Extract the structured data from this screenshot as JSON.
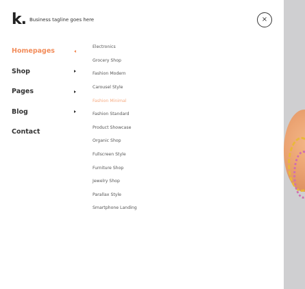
{
  "brand": {
    "logo_text": "k.",
    "tagline": "Business tagline goes here"
  },
  "close_button": {
    "symbol": "×"
  },
  "main_menu": [
    {
      "label": "Homepages",
      "has_submenu": true,
      "active": true
    },
    {
      "label": "Shop",
      "has_submenu": true,
      "active": false
    },
    {
      "label": "Pages",
      "has_submenu": true,
      "active": false
    },
    {
      "label": "Blog",
      "has_submenu": true,
      "active": false
    },
    {
      "label": "Contact",
      "has_submenu": false,
      "active": false
    }
  ],
  "submenu": {
    "items": [
      {
        "label": "Electronics",
        "active": false
      },
      {
        "label": "Grocery Shop",
        "active": false
      },
      {
        "label": "Fashion Modern",
        "active": false
      },
      {
        "label": "Carousel Style",
        "active": false
      },
      {
        "label": "Fashion Minimal",
        "active": true
      },
      {
        "label": "Fashion Standard",
        "active": false
      },
      {
        "label": "Product Showcase",
        "active": false
      },
      {
        "label": "Organic Shop",
        "active": false
      },
      {
        "label": "Fullscreen Style",
        "active": false
      },
      {
        "label": "Furniture Shop",
        "active": false
      },
      {
        "label": "Jewelry Shop",
        "active": false
      },
      {
        "label": "Parallax Style",
        "active": false
      },
      {
        "label": "Smartphone Landing",
        "active": false
      }
    ]
  },
  "colors": {
    "accent": "#f28c5a",
    "submenu_active": "#f6a97f",
    "text": "#333333",
    "background_strip": "#cfcfd1"
  }
}
